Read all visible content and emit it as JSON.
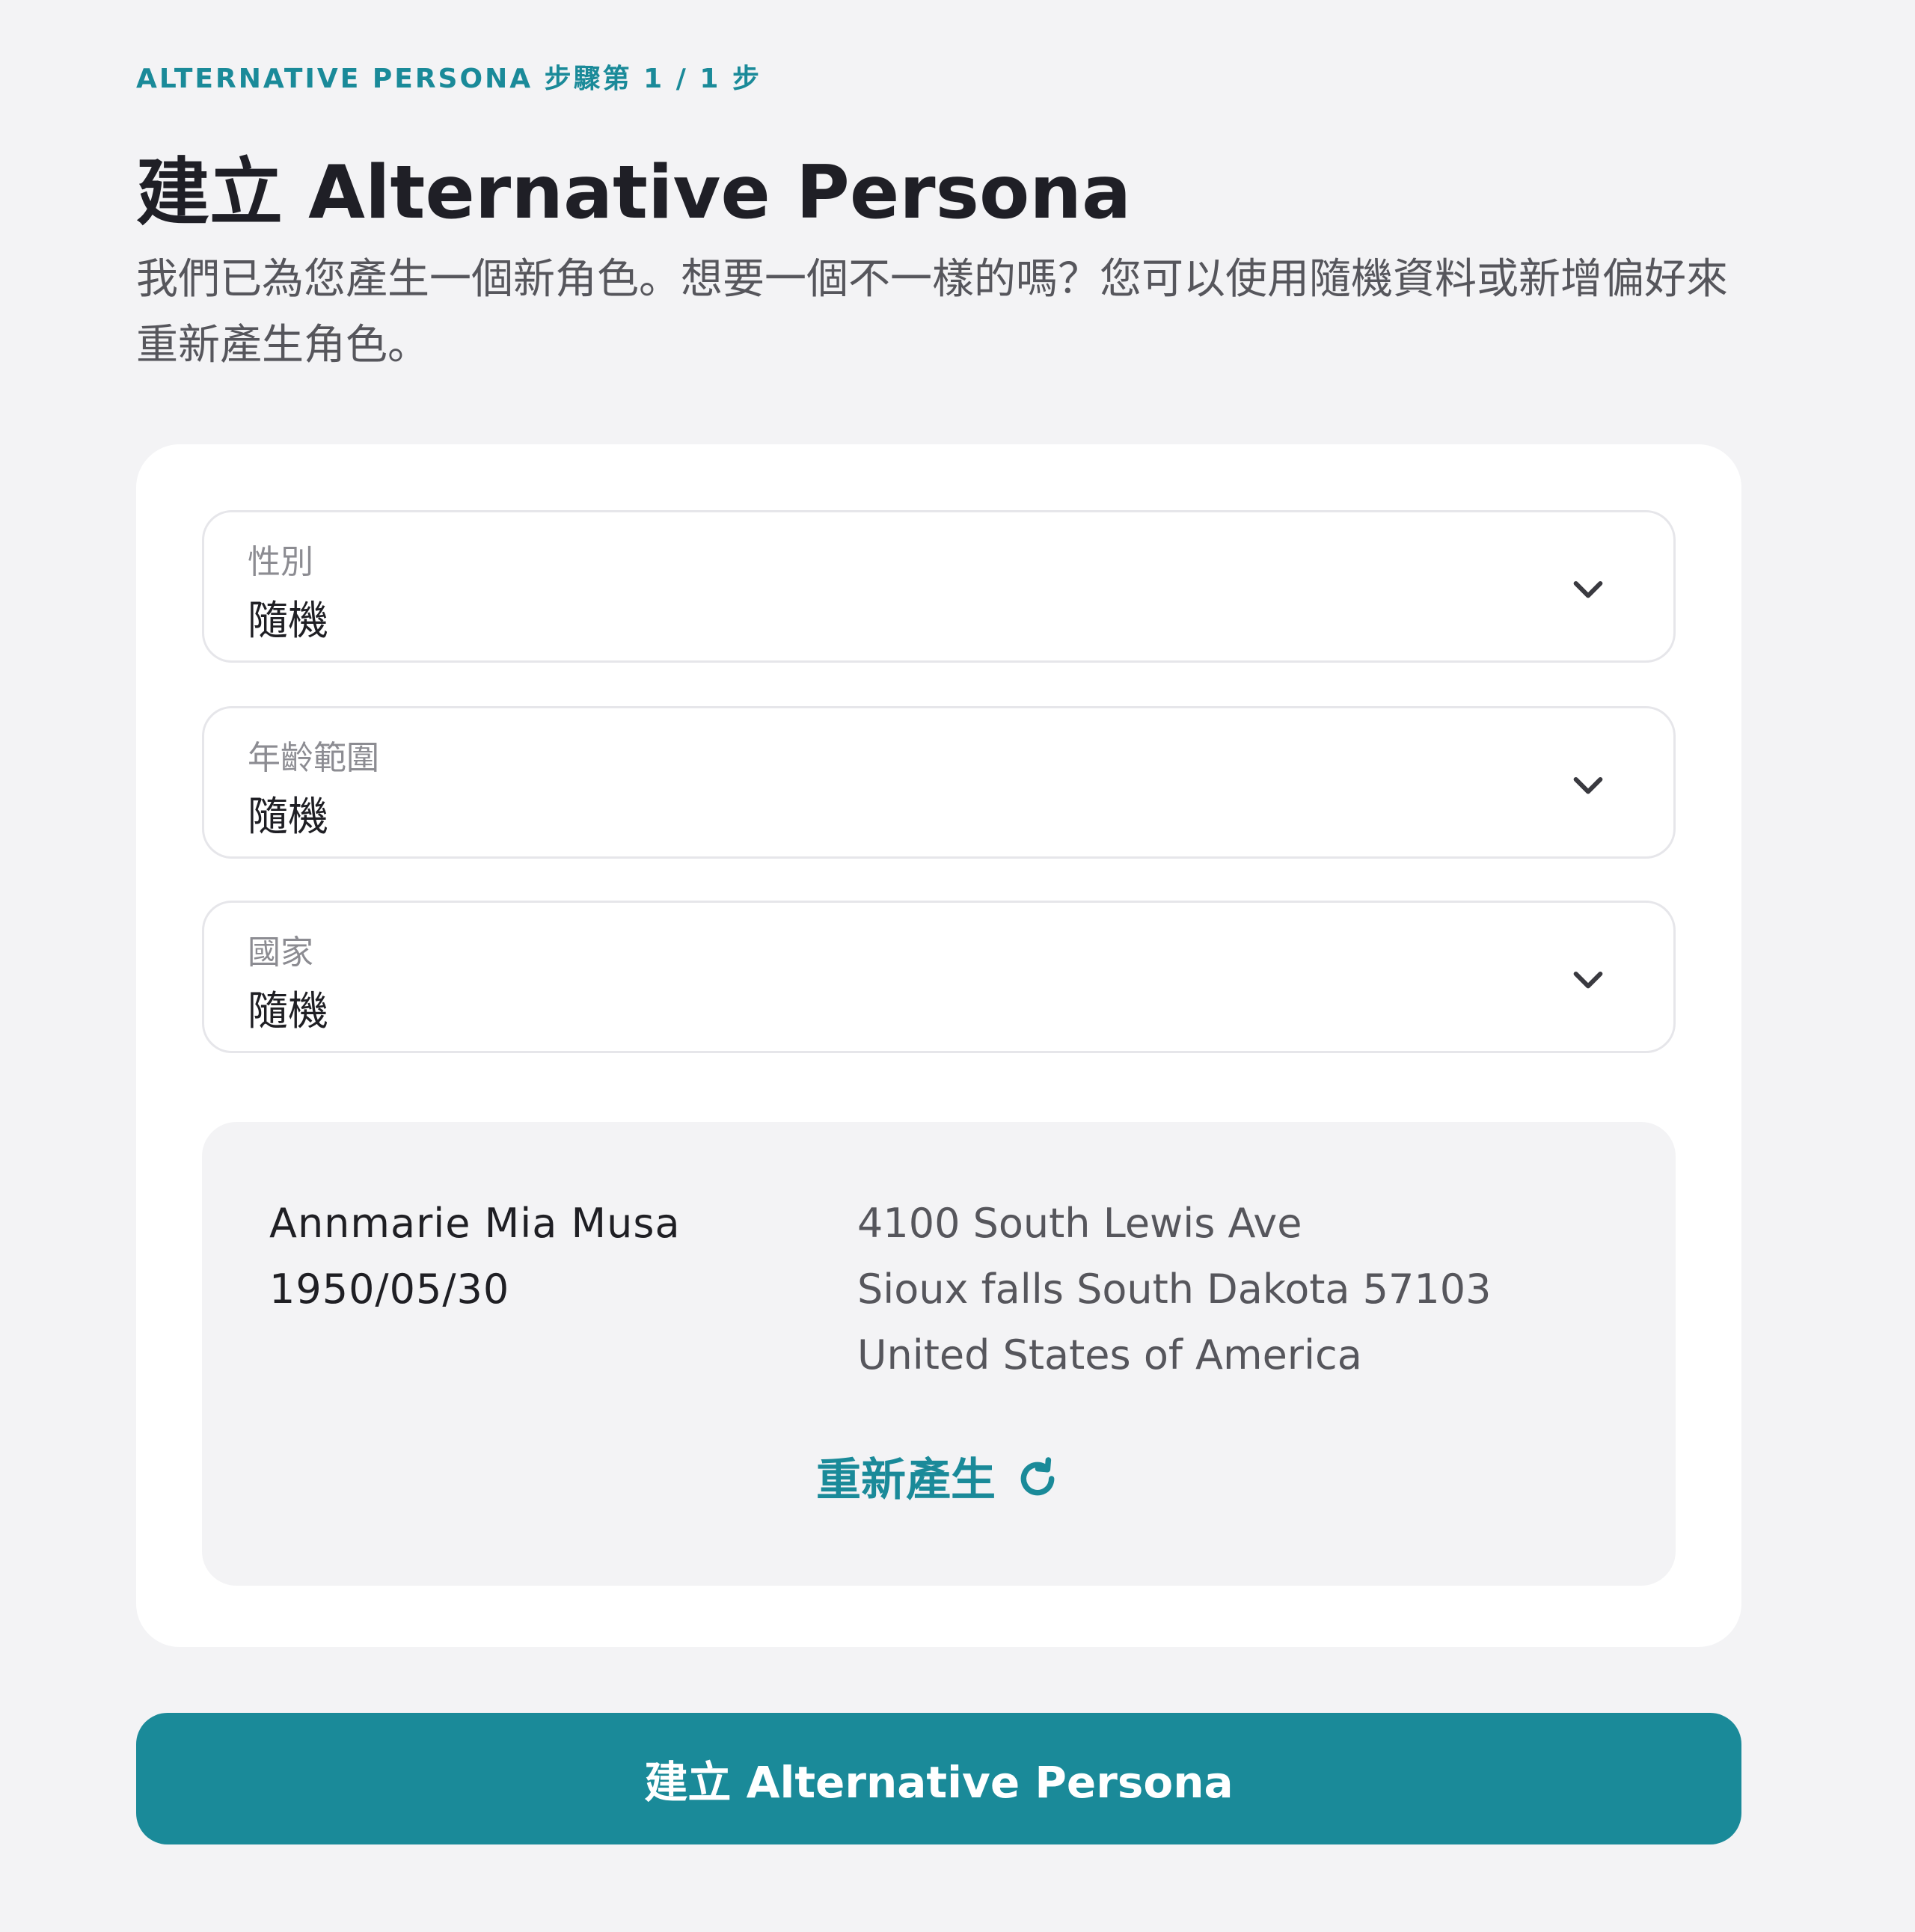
{
  "step_label": "ALTERNATIVE PERSONA 步驟第 1 / 1 步",
  "title": "建立 Alternative Persona",
  "subtitle": "我們已為您產生一個新角色。想要一個不一樣的嗎？您可以使用隨機資料或新增偏好來重新產生角色。",
  "fields": [
    {
      "label": "性別",
      "value": "隨機",
      "icon": "chevron-down-icon"
    },
    {
      "label": "年齡範圍",
      "value": "隨機",
      "icon": "chevron-down-icon"
    },
    {
      "label": "國家",
      "value": "隨機",
      "icon": "chevron-down-icon"
    }
  ],
  "persona": {
    "name": "Annmarie Mia Musa",
    "birthdate": "1950/05/30",
    "address_line1": "4100 South Lewis Ave",
    "address_line2": "Sioux falls South Dakota 57103",
    "address_line3": "United States of America"
  },
  "regenerate_label": "重新產生",
  "regenerate_icon": "refresh-icon",
  "create_button_label": "建立 Alternative Persona",
  "colors": {
    "accent": "#1a8a99",
    "background": "#f3f3f5",
    "card": "#ffffff"
  }
}
